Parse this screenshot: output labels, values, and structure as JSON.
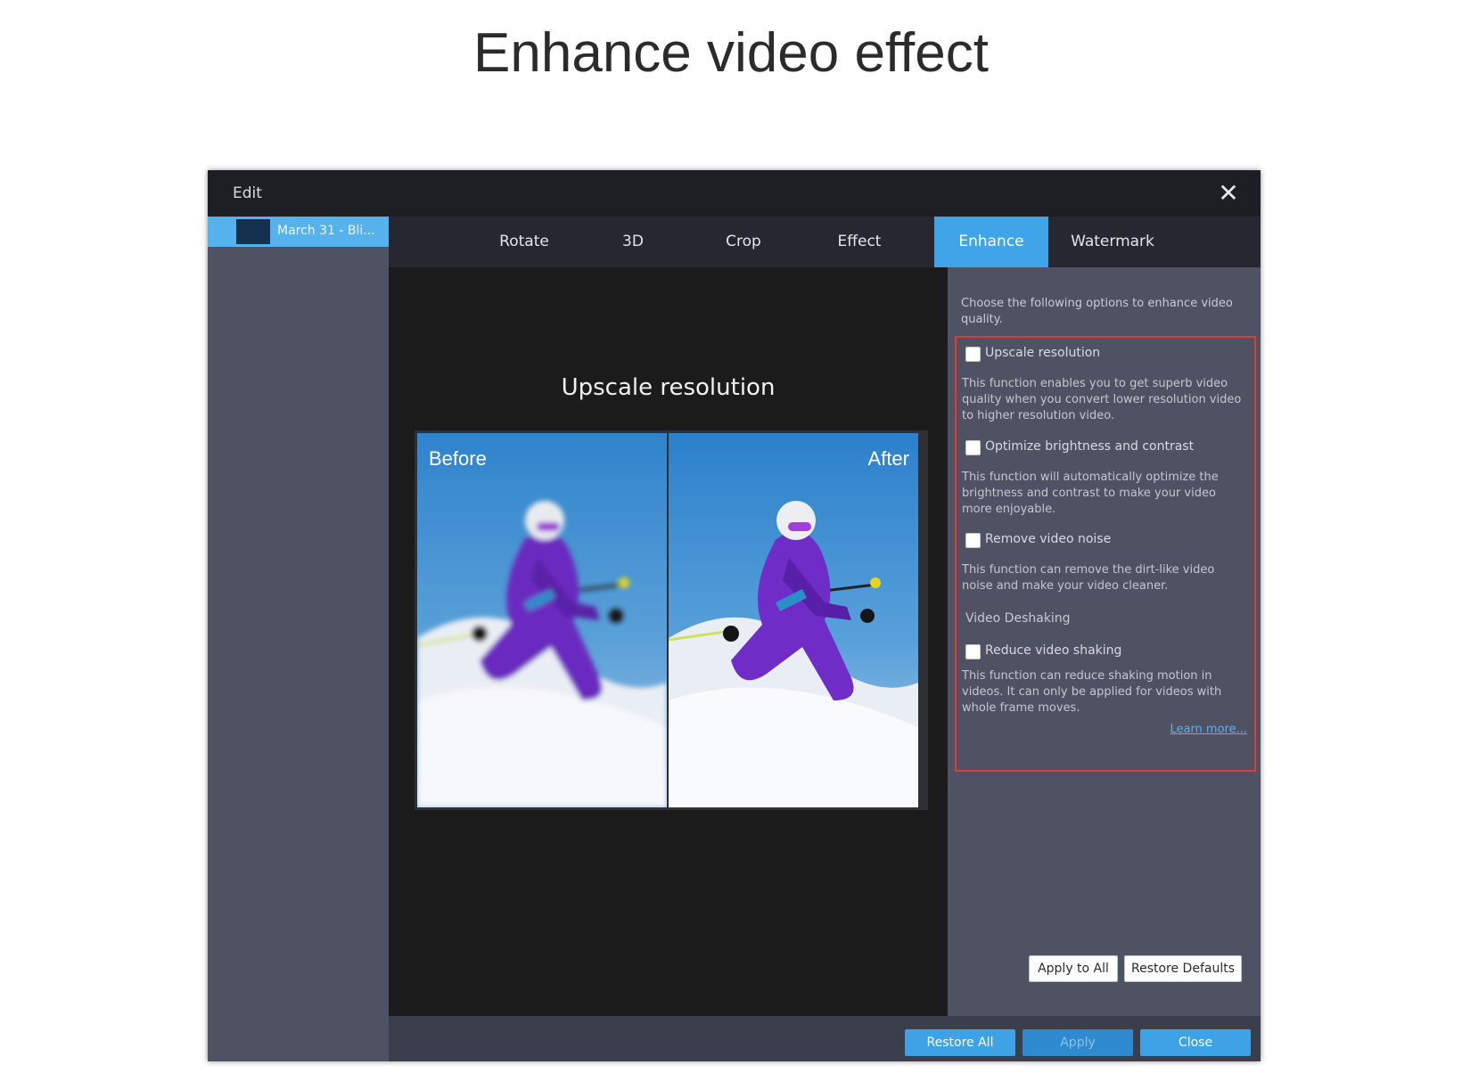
{
  "page_title": "Enhance video effect",
  "window": {
    "title": "Edit",
    "close_icon": "close-icon",
    "close_glyph": "✕"
  },
  "sidebar": {
    "file_name": "March 31 - Bli..."
  },
  "tabs": [
    {
      "label": "Rotate",
      "active": false
    },
    {
      "label": "3D",
      "active": false
    },
    {
      "label": "Crop",
      "active": false
    },
    {
      "label": "Effect",
      "active": false
    },
    {
      "label": "Enhance",
      "active": true
    },
    {
      "label": "Watermark",
      "active": false
    }
  ],
  "preview": {
    "heading": "Upscale resolution",
    "before_label": "Before",
    "after_label": "After"
  },
  "panel": {
    "intro": "Choose the following options to enhance video quality.",
    "options": [
      {
        "label": "Upscale resolution",
        "checked": false,
        "description": "This function enables you to get superb video quality when you convert lower resolution video to higher resolution video."
      },
      {
        "label": "Optimize brightness and contrast",
        "checked": false,
        "description": "This function will automatically optimize the brightness and contrast to make your video more enjoyable."
      },
      {
        "label": "Remove video noise",
        "checked": false,
        "description": "This function can remove the dirt-like video noise and make your video cleaner."
      }
    ],
    "deshake_section": "Video Deshaking",
    "deshake_option": {
      "label": "Reduce video shaking",
      "checked": false,
      "description": "This function can reduce shaking motion in videos. It can only be applied for videos with whole frame moves."
    },
    "learn_more": "Learn more...",
    "apply_all": "Apply to All",
    "restore_defaults": "Restore Defaults"
  },
  "footer": {
    "restore_all": "Restore All",
    "apply": "Apply",
    "close": "Close"
  },
  "colors": {
    "accent": "#3fa5e8",
    "highlight_border": "#e23b35",
    "panel_bg": "#4e5262"
  }
}
